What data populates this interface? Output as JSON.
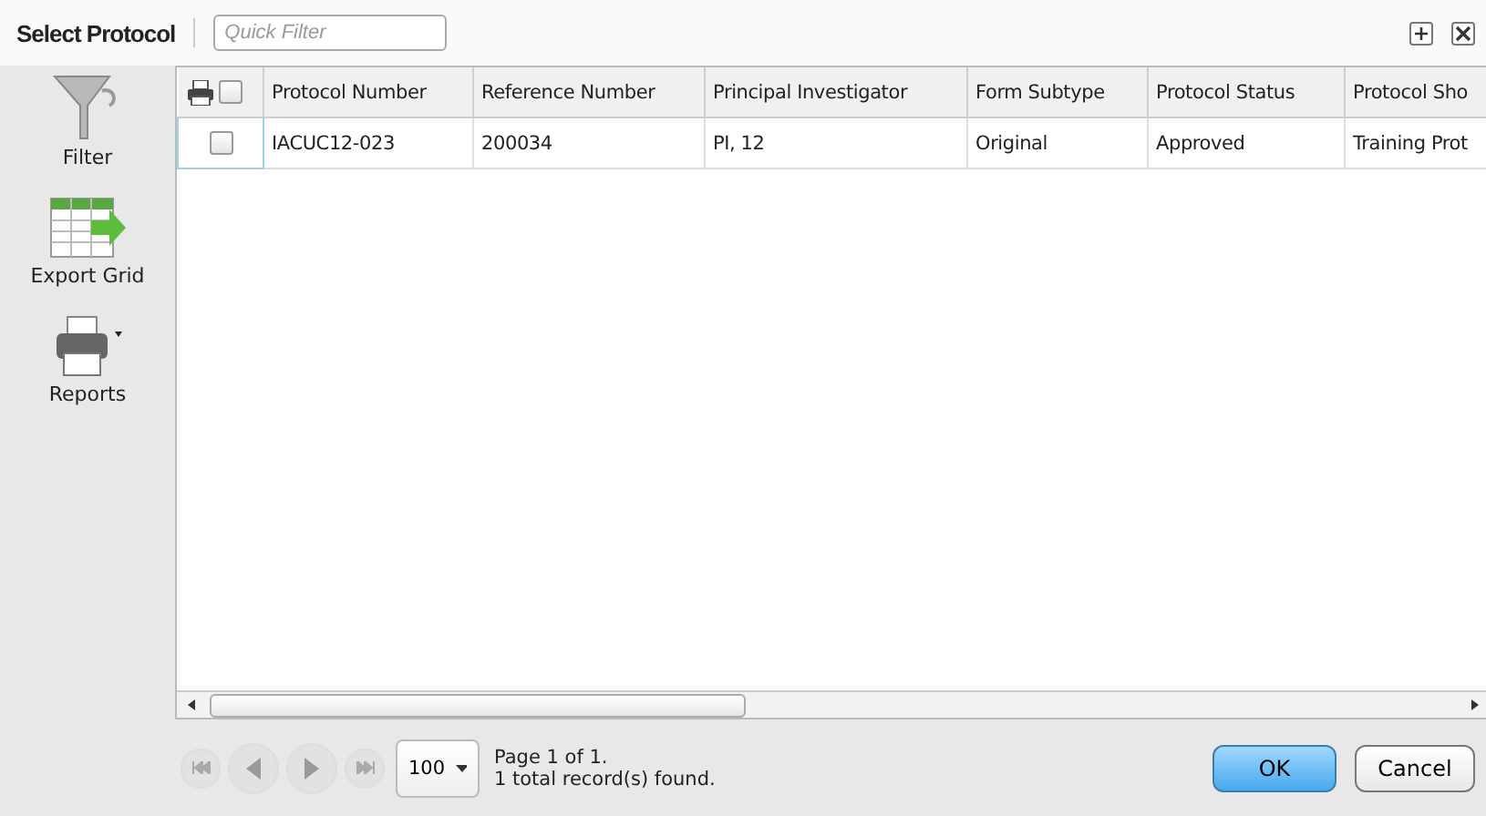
{
  "title": "Select Protocol",
  "quick_filter": {
    "placeholder": "Quick Filter"
  },
  "sidebar": [
    {
      "kind": "filter",
      "label": "Filter"
    },
    {
      "kind": "export",
      "label": "Export Grid"
    },
    {
      "kind": "reports",
      "label": "Reports"
    }
  ],
  "table": {
    "header_checked": false,
    "columns": [
      "Protocol Number",
      "Reference Number",
      "Principal Investigator",
      "Form Subtype",
      "Protocol Status",
      "Protocol Sho"
    ],
    "rows": [
      {
        "checked": false,
        "cells": [
          "IACUC12-023",
          "200034",
          "PI, 12",
          "Original",
          "Approved",
          "Training Prot"
        ]
      }
    ]
  },
  "pager": {
    "page_size": "100",
    "page_info": "Page 1 of 1.",
    "records": "1 total record(s) found."
  },
  "buttons": [
    {
      "label": "OK",
      "kind": "primary"
    },
    {
      "label": "Cancel",
      "kind": "secondary"
    }
  ]
}
